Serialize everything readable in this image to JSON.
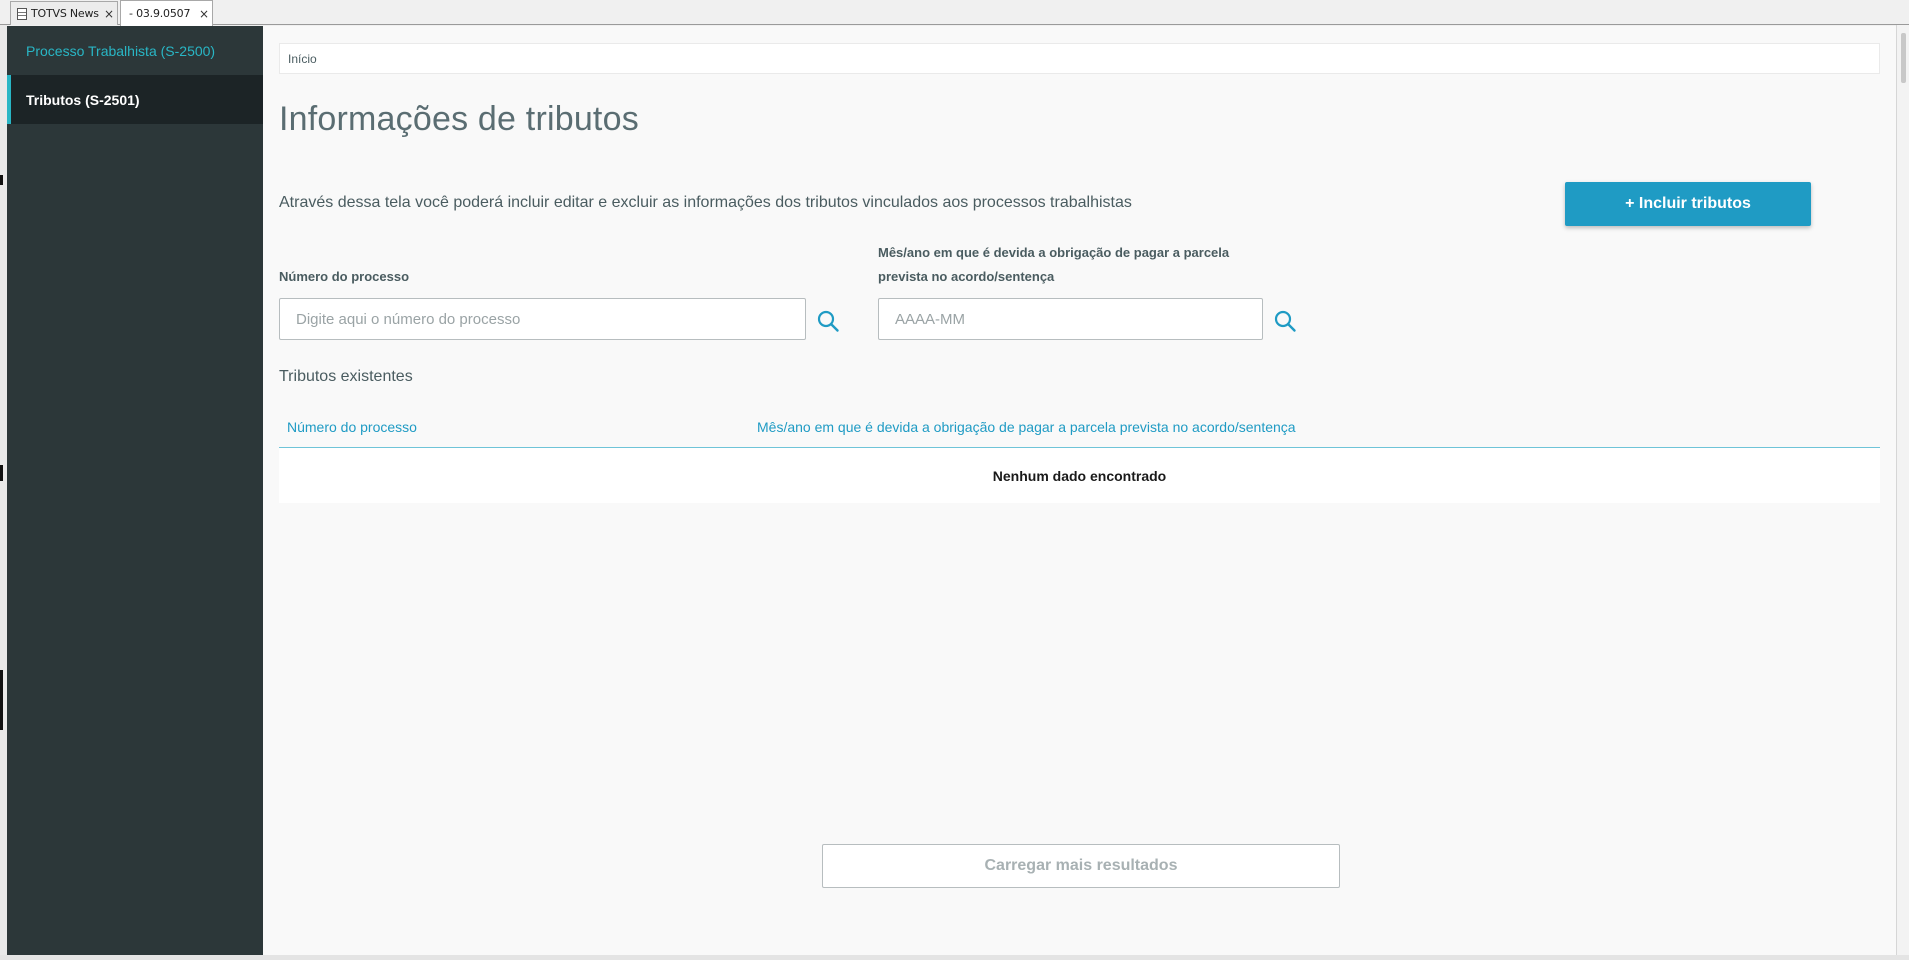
{
  "tabs": [
    {
      "label": "TOTVS News",
      "close": "×"
    },
    {
      "label": "- 03.9.0507",
      "close": "×"
    }
  ],
  "sidebar": {
    "items": [
      {
        "label": "Processo Trabalhista (S-2500)"
      },
      {
        "label": "Tributos (S-2501)"
      }
    ]
  },
  "breadcrumb": {
    "label": "Início"
  },
  "page": {
    "title": "Informações de tributos",
    "description": "Através dessa tela você poderá incluir editar e excluir as informações dos tributos vinculados aos processos trabalhistas",
    "add_button": "+ Incluir tributos"
  },
  "filters": {
    "processo": {
      "label": "Número do processo",
      "placeholder": "Digite aqui o número do processo",
      "value": ""
    },
    "mes": {
      "label": "Mês/ano em que é devida a obrigação de pagar a parcela prevista no acordo/sentença",
      "placeholder": "AAAA-MM",
      "value": ""
    }
  },
  "table": {
    "title": "Tributos existentes",
    "columns": [
      "Número do processo",
      "Mês/ano em que é devida a obrigação de pagar a parcela prevista no acordo/sentença"
    ],
    "rows": [],
    "empty_message": "Nenhum dado encontrado"
  },
  "load_more": "Carregar mais resultados",
  "colors": {
    "accent": "#1f9bc4",
    "sidebar_bg": "#2c3739",
    "sidebar_active_bg": "#1c2426",
    "sidebar_link": "#29b6c5"
  },
  "icons": {
    "tab": "document-icon",
    "search": "search-icon",
    "close": "close-icon"
  }
}
